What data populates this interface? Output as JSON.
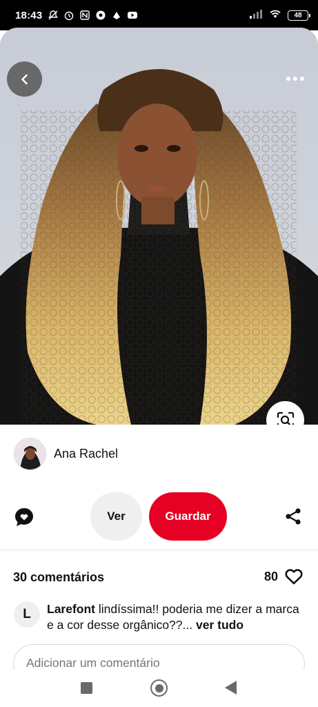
{
  "status_bar": {
    "time": "18:43",
    "battery": "48",
    "icons": [
      "notifications-off-icon",
      "alarm-icon",
      "nfc-icon",
      "chrome-icon",
      "app-icon",
      "youtube-icon",
      "signal-icon",
      "wifi-icon",
      "battery-icon"
    ]
  },
  "pin": {
    "image_description_icon": "hair-photo",
    "back_icon": "chevron-left-icon",
    "more_icon": "more-horizontal-icon",
    "visual_search_icon": "lens-search-icon"
  },
  "creator": {
    "name": "Ana Rachel"
  },
  "actions": {
    "comment_icon": "speech-bubble-heart-icon",
    "view_label": "Ver",
    "save_label": "Guardar",
    "share_icon": "share-icon",
    "save_color": "#e60023"
  },
  "comments": {
    "count_label": "30 comentários",
    "reaction_count": "80",
    "items": [
      {
        "avatar_letter": "L",
        "author": "Larefont",
        "text": "lindíssima!! poderia me dizer a marca e a cor desse orgânico??...",
        "see_all": "ver tudo"
      }
    ],
    "add_placeholder": "Adicionar um comentário"
  },
  "nav_bar": {
    "icons": [
      "recent-apps-icon",
      "home-icon",
      "back-icon"
    ]
  }
}
